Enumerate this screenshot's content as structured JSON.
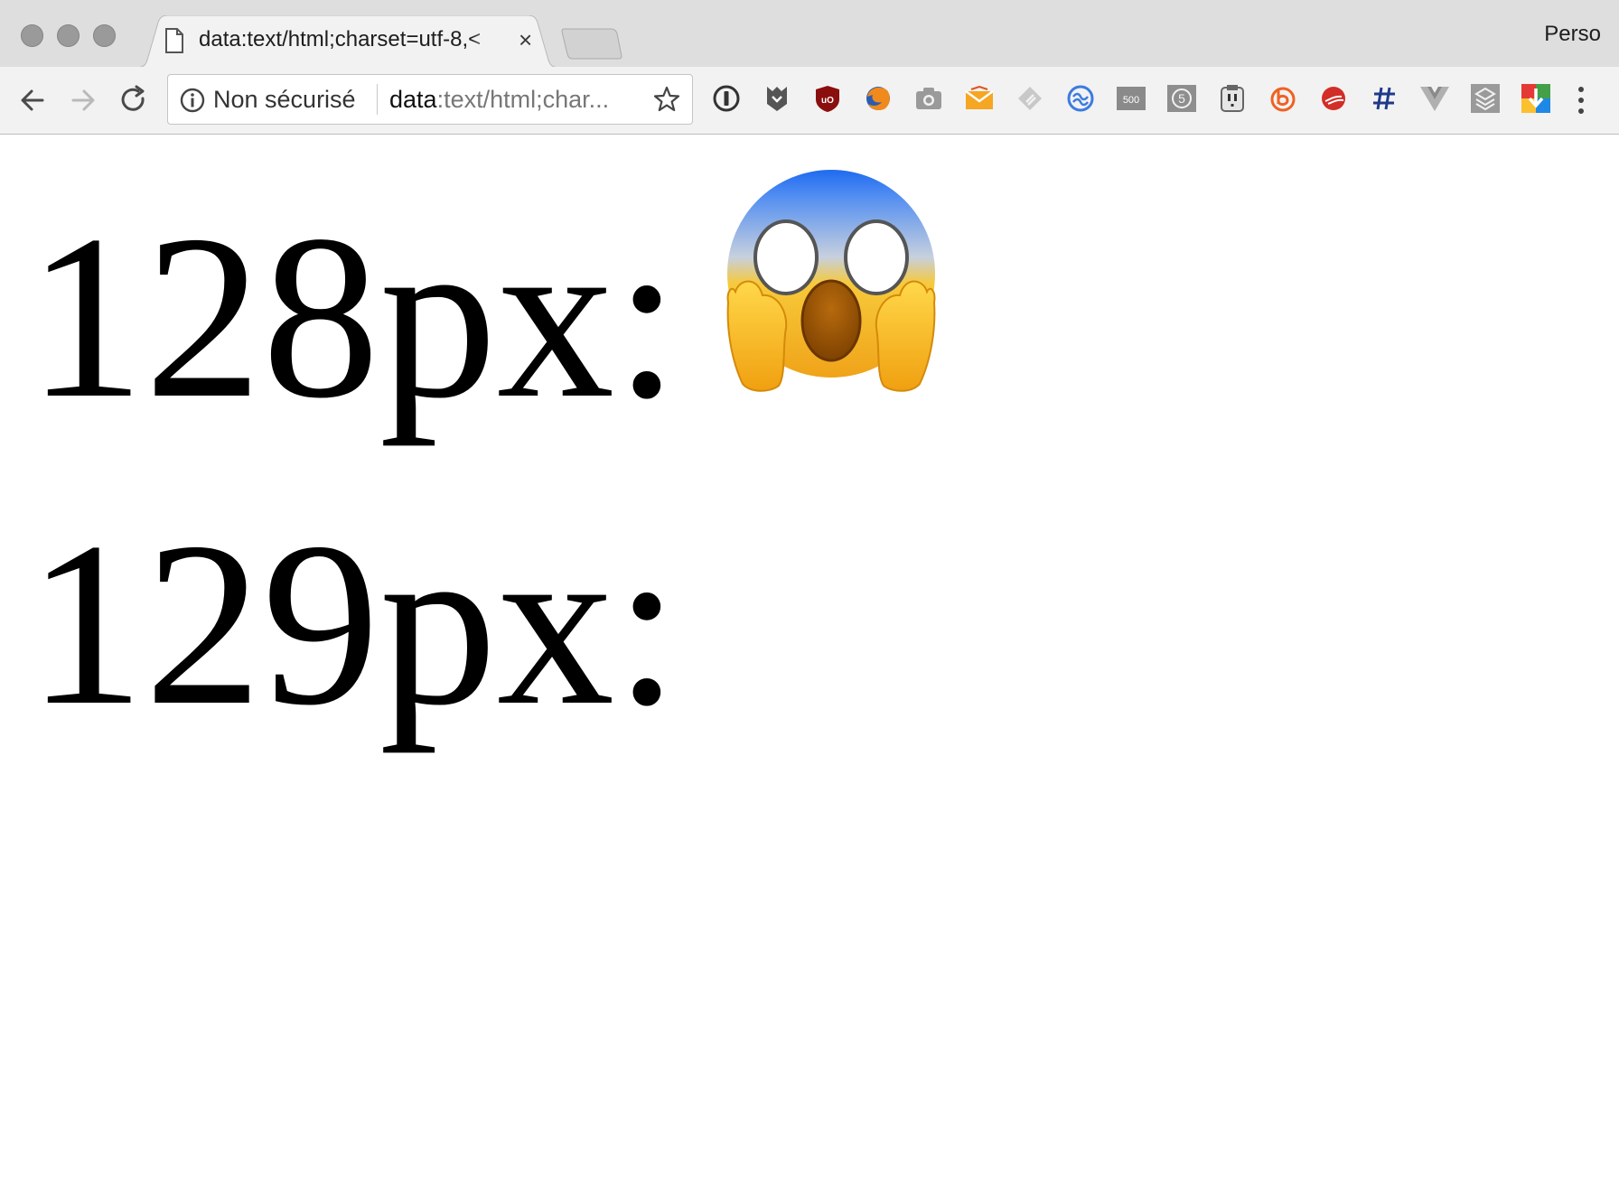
{
  "browser": {
    "tab": {
      "title": "data:text/html;charset=utf-8,<"
    },
    "profile_name": "Perso",
    "omnibox": {
      "security_label": "Non sécurisé",
      "url_scheme": "data",
      "url_rest": ":text/html;char..."
    },
    "extensions": [
      "1password-icon",
      "ghostery-icon",
      "ublock-icon",
      "firefox-icon",
      "camera-icon",
      "mailtrack-icon",
      "feedly-icon",
      "workona-icon",
      "500px-icon",
      "pocket-five-icon",
      "noscript-icon",
      "bitly-icon",
      "lastpass-icon",
      "hashtag-icon",
      "vue-devtools-icon",
      "layers-icon",
      "google-keep-icon"
    ]
  },
  "page": {
    "line1": "128px:",
    "line2": "129px:",
    "emoji_name": "face-screaming-in-fear"
  }
}
